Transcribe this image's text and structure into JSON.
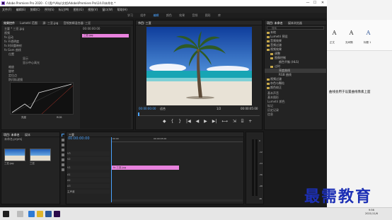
{
  "window": {
    "title": "Adobe Premiere Pro 2020 - C:\\用户\\Aby\\文档\\Adobe\\Premiere Pro\\14.0\\未命名 *",
    "controls": [
      "—",
      "☐",
      "✕"
    ]
  },
  "menu": [
    "文件(F)",
    "编辑(E)",
    "剪辑(C)",
    "序列(S)",
    "标记(M)",
    "图形(G)",
    "视图(V)",
    "窗口(W)",
    "帮助(H)"
  ],
  "workspaces": {
    "items": [
      "学习",
      "组件",
      "编辑",
      "颜色",
      "效果",
      "音频",
      "图形",
      "库"
    ],
    "active": "编辑"
  },
  "effect_controls": {
    "tabs": [
      "效果控件",
      "Lumetri 范围",
      "源: 三亚.jpg"
    ],
    "secondary_tab": "音频剪辑混合器: 三亚",
    "clip_path": "主要 * 三亚.jpg",
    "clip_label": "三亚.jpg",
    "sections": [
      "视频",
      "fx 运动",
      "fx 不透明度",
      "fx 时间重映射",
      "fx Gam 曲线"
    ],
    "params": [
      "位置",
      "缩放",
      "旋转",
      "定位点",
      "防闪烁滤镜"
    ],
    "param_values": [
      "显示",
      "显示中心高光",
      "透明度",
      "100.0 %"
    ],
    "curve_labels": [
      "亮度",
      "饱和度",
      "输出",
      "RGB"
    ],
    "timecode": "00:00:00:00"
  },
  "program_monitor": {
    "title": "节目: 三亚",
    "timecode_current": "00:00:00:00",
    "fit": "适合",
    "ratio": "1/2",
    "timecode_total": "00:00:05:00",
    "controls": [
      "◆",
      "{",
      "}",
      "|◀",
      "◀",
      "▶",
      "▶|",
      "⟷",
      "⇲",
      "⌸",
      "+"
    ]
  },
  "project": {
    "tabs": [
      "项目: 未命名",
      "媒体浏览器"
    ],
    "search_placeholder": "搜索",
    "tree": [
      "本地",
      "Lumetri 预设",
      "音频效果",
      "音频过渡",
      "视频效果",
      "调整",
      "图像控制",
      "颜色平衡 (HLS)",
      "过时",
      "亮度曲线",
      "RGB 曲线",
      "视频过渡",
      "杂色与颗粒",
      "颜色校正"
    ],
    "selected": "亮度曲线",
    "extra": [
      "基本声音",
      "基本图形",
      "Lumetri 颜色",
      "标记",
      "历史记录",
      "信息"
    ]
  },
  "media_browser": {
    "tabs": [
      "项目: 未命名",
      "媒体"
    ],
    "file": "未命名.prproj",
    "thumb_labels": [
      "三亚.jpg",
      "三亚"
    ]
  },
  "timeline": {
    "tab": "三亚",
    "timecode": "00:00:00:00",
    "tracks": [
      "V3",
      "V2",
      "V1",
      "A1",
      "A2",
      "A3",
      "主声道"
    ],
    "clip_label": "fx 三亚.jpg",
    "ruler": [
      "00:00",
      "00:00:05:00"
    ]
  },
  "audio_meter": {
    "scale": [
      "0",
      "-12",
      "-24",
      "-36",
      "-48",
      "dB"
    ]
  },
  "word_doc": {
    "styles": [
      "正文",
      "无间隔",
      "标题 1"
    ],
    "body": "曲线会用于设置曲线像素上面"
  },
  "watermark": "最需教育",
  "taskbar": {
    "time": "9:56",
    "date": "2021/11/6"
  }
}
